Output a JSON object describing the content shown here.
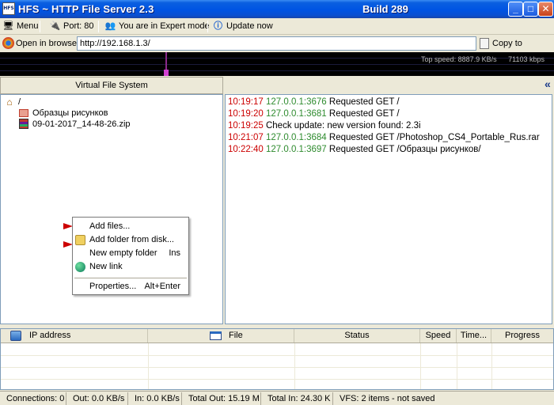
{
  "window": {
    "app_icon_text": "HFS",
    "title": "HFS ~ HTTP File Server 2.3",
    "build": "Build 289",
    "minimize_glyph": "_",
    "maximize_glyph": "□",
    "close_glyph": "✕"
  },
  "toolbar": {
    "menu_label": "Menu",
    "port_label": "Port: 80",
    "mode_label": "You are in Expert mode",
    "update_label": "Update now"
  },
  "urlbar": {
    "open_label": "Open in browser",
    "url_value": "http://192.168.1.3/",
    "copy_label": "Copy to clipboard"
  },
  "graph": {
    "top_speed": "Top speed: 8887.9 KB/s",
    "total": "71103 kbps"
  },
  "vfs": {
    "header": "Virtual File System",
    "root": "/",
    "items": [
      "Образцы рисунков",
      "09-01-2017_14-48-26.zip"
    ]
  },
  "context_menu": {
    "items": [
      {
        "label": "Add files...",
        "shortcut": ""
      },
      {
        "label": "Add folder from disk...",
        "shortcut": ""
      },
      {
        "label": "New empty folder",
        "shortcut": "Ins"
      },
      {
        "label": "New link",
        "shortcut": ""
      },
      {
        "label": "Properties...",
        "shortcut": "Alt+Enter"
      }
    ]
  },
  "log": {
    "collapse_glyph": "«",
    "lines": [
      {
        "time": "10:19:17",
        "ip": "127.0.0.1:3676",
        "msg": "Requested GET /"
      },
      {
        "time": "10:19:20",
        "ip": "127.0.0.1:3681",
        "msg": "Requested GET /"
      },
      {
        "time": "10:19:25",
        "ip": "",
        "msg": "Check update: new version found: 2.3i"
      },
      {
        "time": "10:21:07",
        "ip": "127.0.0.1:3684",
        "msg": "Requested GET /Photoshop_CS4_Portable_Rus.rar"
      },
      {
        "time": "10:22:40",
        "ip": "127.0.0.1:3697",
        "msg": "Requested GET /Образцы рисунков/"
      }
    ]
  },
  "connections": {
    "columns": [
      "IP address",
      "File",
      "Status",
      "Speed",
      "Time...",
      "Progress"
    ]
  },
  "status": {
    "connections": "Connections: 0",
    "out": "Out: 0.0 KB/s",
    "in": "In: 0.0 KB/s",
    "total_out": "Total Out: 15.19 M",
    "total_in": "Total In: 24.30 K",
    "vfs": "VFS: 2 items - not saved"
  },
  "colors": {
    "log_time": "#cc0000",
    "log_ip": "#2e8b2e",
    "title_bar": "#0054e3"
  }
}
